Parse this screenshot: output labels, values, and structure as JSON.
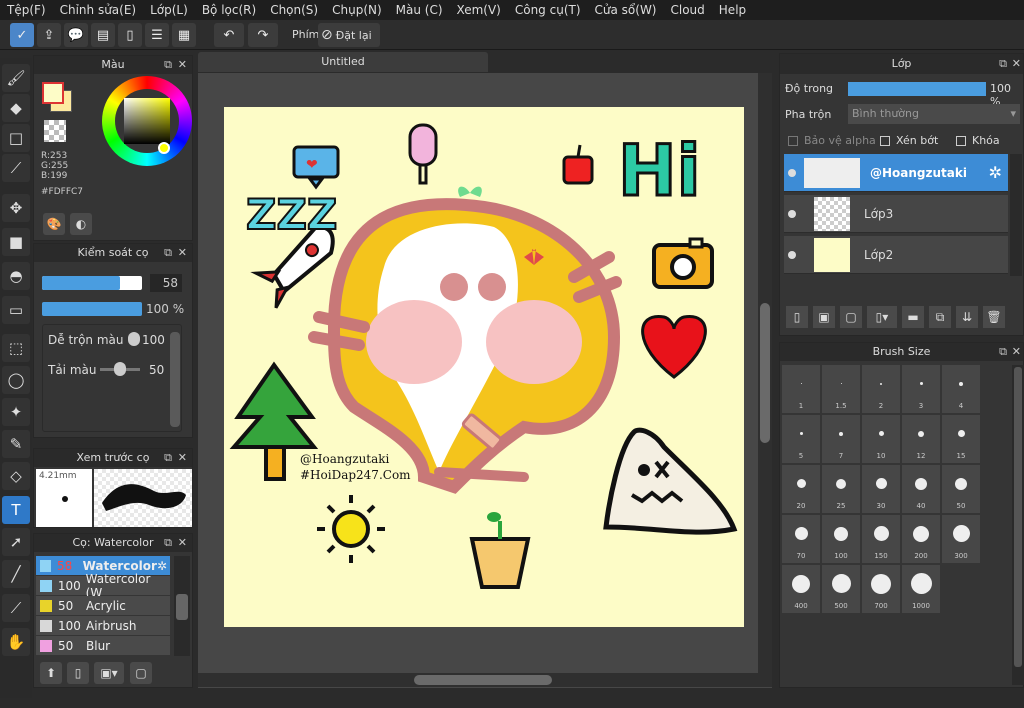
{
  "menu": [
    "Tệp(F)",
    "Chỉnh sửa(E)",
    "Lớp(L)",
    "Bộ lọc(R)",
    "Chọn(S)",
    "Chụp(N)",
    "Màu (C)",
    "Xem(V)",
    "Công cụ(T)",
    "Cửa sổ(W)",
    "Cloud",
    "Help"
  ],
  "toolbar": {
    "phim_label": "Phím",
    "reset_label": "Đặt lại"
  },
  "document_tab": "Untitled",
  "color_panel": {
    "title": "Màu",
    "r": "R:253",
    "g": "G:255",
    "b": "B:199",
    "hex": "#FDFFC7",
    "fg_color": "#fdfcc7",
    "accent": "#4a9de0"
  },
  "brush_control": {
    "title": "Kiểm soát cọ",
    "size_value": "58",
    "opacity_value": "100 %",
    "blend_label": "Dễ trộn màu",
    "blend_value": "100",
    "amount_label": "Tải màu",
    "amount_value": "50"
  },
  "preview": {
    "title": "Xem trước cọ",
    "size_text": "4.21mm"
  },
  "brush_list": {
    "title": "Cọ: Watercolor",
    "items": [
      {
        "size": "58",
        "name": "Watercolor",
        "color": "#8fd3f4"
      },
      {
        "size": "100",
        "name": "Watercolor (W",
        "color": "#8fd3f4"
      },
      {
        "size": "50",
        "name": "Acrylic",
        "color": "#e8d32a"
      },
      {
        "size": "100",
        "name": "Airbrush",
        "color": "#d8d8d8"
      },
      {
        "size": "50",
        "name": "Blur",
        "color": "#f0a0e0"
      }
    ]
  },
  "layer_panel": {
    "title": "Lớp",
    "opacity_label": "Độ trong",
    "opacity_value": "100 %",
    "blend_label": "Pha trộn",
    "blend_value": "Bình thường",
    "protect_alpha": "Bảo vệ alpha",
    "clipping": "Xén bớt",
    "lock": "Khóa",
    "layers": [
      {
        "name": "@Hoangzutaki"
      },
      {
        "name": "Lớp3"
      },
      {
        "name": "Lớp2"
      }
    ]
  },
  "brush_size": {
    "title": "Brush Size",
    "sizes": [
      "1",
      "1.5",
      "2",
      "3",
      "4",
      "5",
      "7",
      "10",
      "12",
      "15",
      "20",
      "25",
      "30",
      "40",
      "50",
      "70",
      "100",
      "150",
      "200",
      "300",
      "400",
      "500",
      "700",
      "1000"
    ]
  },
  "artwork": {
    "zzz": "ZZZ",
    "hi": "Hi",
    "watermark1": "@Hoangzutaki",
    "watermark2": "#HoiDap247.Com"
  }
}
